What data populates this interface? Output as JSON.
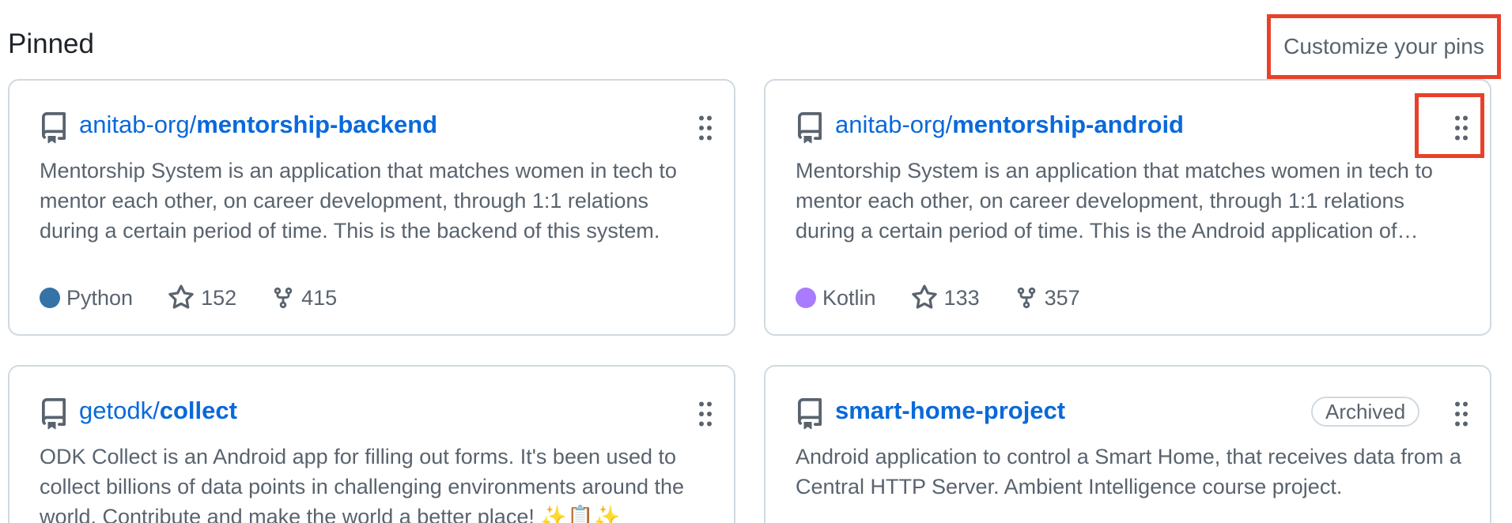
{
  "section": {
    "title": "Pinned",
    "customize_label": "Customize your pins"
  },
  "colors": {
    "link": "#0969da",
    "python": "#3572A5",
    "kotlin": "#A97BFF",
    "highlight": "#e8412a"
  },
  "cards": [
    {
      "owner": "anitab-org/",
      "name": "mentorship-backend",
      "description": "Mentorship System is an application that matches women in tech to mentor each other, on career development, through 1:1 relations during a certain period of time. This is the backend of this system.",
      "language": "Python",
      "stars": "152",
      "forks": "415"
    },
    {
      "owner": "anitab-org/",
      "name": "mentorship-android",
      "description": "Mentorship System is an application that matches women in tech to mentor each other, on career development, through 1:1 relations during a certain period of time. This is the Android application of…",
      "language": "Kotlin",
      "stars": "133",
      "forks": "357"
    },
    {
      "owner": "getodk/",
      "name": "collect",
      "description": "ODK Collect is an Android app for filling out forms. It's been used to collect billions of data points in challenging environments around the world. Contribute and make the world a better place! ✨📋✨"
    },
    {
      "owner": "",
      "name": "smart-home-project",
      "badge": "Archived",
      "description": "Android application to control a Smart Home, that receives data from a Central HTTP Server. Ambient Intelligence course project."
    }
  ]
}
